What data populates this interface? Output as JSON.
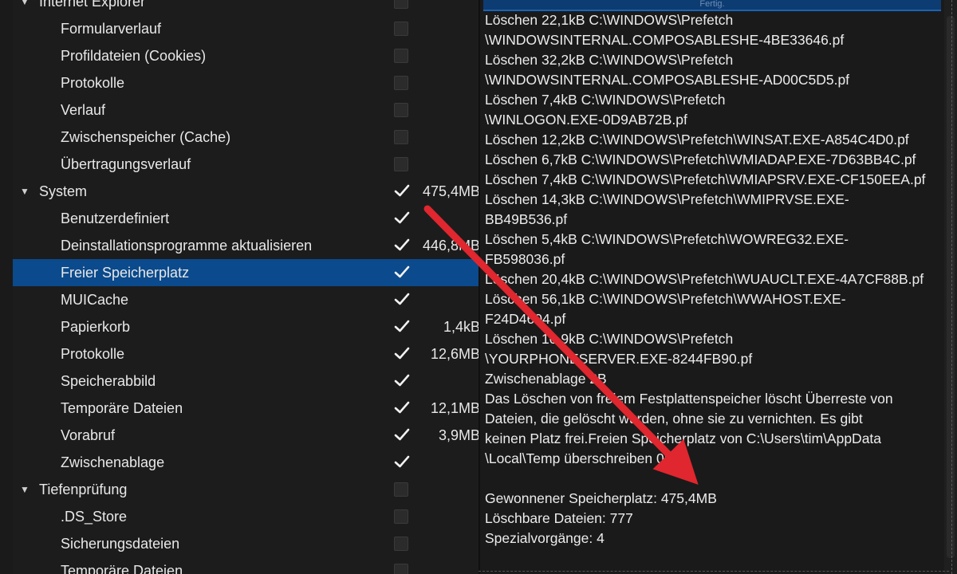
{
  "tree": {
    "rows": [
      {
        "type": "cat",
        "label": "Internet Explorer",
        "checked": false,
        "size": "",
        "expanded": true
      },
      {
        "type": "item",
        "label": "Formularverlauf",
        "checked": false,
        "size": ""
      },
      {
        "type": "item",
        "label": "Profildateien (Cookies)",
        "checked": false,
        "size": ""
      },
      {
        "type": "item",
        "label": "Protokolle",
        "checked": false,
        "size": ""
      },
      {
        "type": "item",
        "label": "Verlauf",
        "checked": false,
        "size": ""
      },
      {
        "type": "item",
        "label": "Zwischenspeicher (Cache)",
        "checked": false,
        "size": ""
      },
      {
        "type": "item",
        "label": "Übertragungsverlauf",
        "checked": false,
        "size": ""
      },
      {
        "type": "cat",
        "label": "System",
        "checked": true,
        "size": "475,4MB",
        "expanded": true
      },
      {
        "type": "item",
        "label": "Benutzerdefiniert",
        "checked": true,
        "size": ""
      },
      {
        "type": "item",
        "label": "Deinstallationsprogramme aktualisieren",
        "checked": true,
        "size": "446,8MB"
      },
      {
        "type": "item",
        "label": "Freier Speicherplatz",
        "checked": true,
        "size": "",
        "selected": true
      },
      {
        "type": "item",
        "label": "MUICache",
        "checked": true,
        "size": ""
      },
      {
        "type": "item",
        "label": "Papierkorb",
        "checked": true,
        "size": "1,4kB"
      },
      {
        "type": "item",
        "label": "Protokolle",
        "checked": true,
        "size": "12,6MB"
      },
      {
        "type": "item",
        "label": "Speicherabbild",
        "checked": true,
        "size": ""
      },
      {
        "type": "item",
        "label": "Temporäre Dateien",
        "checked": true,
        "size": "12,1MB"
      },
      {
        "type": "item",
        "label": "Vorabruf",
        "checked": true,
        "size": "3,9MB"
      },
      {
        "type": "item",
        "label": "Zwischenablage",
        "checked": true,
        "size": ""
      },
      {
        "type": "cat",
        "label": "Tiefenprüfung",
        "checked": false,
        "size": "",
        "expanded": true
      },
      {
        "type": "item",
        "label": ".DS_Store",
        "checked": false,
        "size": ""
      },
      {
        "type": "item",
        "label": "Sicherungsdateien",
        "checked": false,
        "size": ""
      },
      {
        "type": "item",
        "label": "Temporäre Dateien",
        "checked": false,
        "size": ""
      }
    ]
  },
  "progress": {
    "label": "Fertig."
  },
  "log": {
    "lines": [
      "Löschen 22,1kB C:\\WINDOWS\\Prefetch",
      "\\WINDOWSINTERNAL.COMPOSABLESHE-4BE33646.pf",
      "Löschen 32,2kB C:\\WINDOWS\\Prefetch",
      "\\WINDOWSINTERNAL.COMPOSABLESHE-AD00C5D5.pf",
      "Löschen 7,4kB C:\\WINDOWS\\Prefetch",
      "\\WINLOGON.EXE-0D9AB72B.pf",
      "Löschen 12,2kB C:\\WINDOWS\\Prefetch\\WINSAT.EXE-A854C4D0.pf",
      "Löschen 6,7kB C:\\WINDOWS\\Prefetch\\WMIADAP.EXE-7D63BB4C.pf",
      "Löschen 7,4kB C:\\WINDOWS\\Prefetch\\WMIAPSRV.EXE-CF150EEA.pf",
      "Löschen 14,3kB C:\\WINDOWS\\Prefetch\\WMIPRVSE.EXE-",
      "BB49B536.pf",
      "Löschen 5,4kB C:\\WINDOWS\\Prefetch\\WOWREG32.EXE-",
      "FB598036.pf",
      "Löschen 20,4kB C:\\WINDOWS\\Prefetch\\WUAUCLT.EXE-4A7CF88B.pf",
      "Löschen 56,1kB C:\\WINDOWS\\Prefetch\\WWAHOST.EXE-",
      "F24D4604.pf",
      "Löschen 10,9kB C:\\WINDOWS\\Prefetch",
      "\\YOURPHONESERVER.EXE-8244FB90.pf",
      "Zwischenablage 2B",
      "Das Löschen von freiem Festplattenspeicher löscht Überreste von",
      "Dateien, die gelöscht wurden, ohne sie zu vernichten. Es gibt",
      "keinen Platz frei.Freien Speicherplatz von C:\\Users\\tim\\AppData",
      "\\Local\\Temp überschreiben 0B",
      "",
      "Gewonnener Speicherplatz: 475,4MB",
      "Löschbare Dateien: 777",
      "Spezialvorgänge: 4"
    ]
  },
  "colors": {
    "arrow": "#e0262e",
    "selection": "#0b4a8c"
  },
  "icons": {
    "expand": "chevron-down-icon",
    "check": "checkmark-icon"
  }
}
